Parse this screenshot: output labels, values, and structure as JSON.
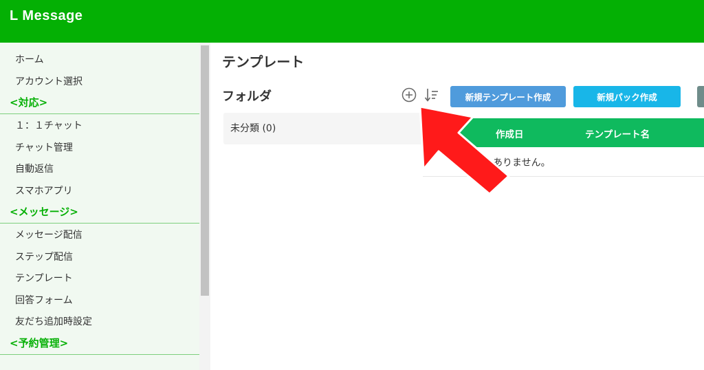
{
  "app": {
    "title": "L Message"
  },
  "sidebar": {
    "items": [
      {
        "type": "item",
        "label": "ホーム"
      },
      {
        "type": "item",
        "label": "アカウント選択"
      },
      {
        "type": "section",
        "label": "<対応>"
      },
      {
        "type": "item",
        "label": "１：１チャット"
      },
      {
        "type": "item",
        "label": "チャット管理"
      },
      {
        "type": "item",
        "label": "自動返信"
      },
      {
        "type": "item",
        "label": "スマホアプリ"
      },
      {
        "type": "section",
        "label": "<メッセージ>"
      },
      {
        "type": "item",
        "label": "メッセージ配信"
      },
      {
        "type": "item",
        "label": "ステップ配信"
      },
      {
        "type": "item",
        "label": "テンプレート"
      },
      {
        "type": "item",
        "label": "回答フォーム"
      },
      {
        "type": "item",
        "label": "友だち追加時設定"
      },
      {
        "type": "section",
        "label": "<予約管理>"
      }
    ]
  },
  "main": {
    "page_title": "テンプレート",
    "folder_title": "フォルダ",
    "add_folder_icon": "plus-circle-icon",
    "sort_icon": "sort-descending-icon",
    "new_template_button": "新規テンプレート作成",
    "new_pack_button": "新規パック作成",
    "folders": [
      {
        "label": "未分類 (0)"
      }
    ],
    "table": {
      "columns": [
        "作成日",
        "テンプレート名"
      ],
      "empty_text": "ありません。"
    }
  },
  "annotation": {
    "icon": "red-arrow-icon",
    "color": "#ff1a1a"
  },
  "colors": {
    "header": "#04b004",
    "sidebar_bg": "#f1f9f1",
    "section": "#06b006",
    "button_blue": "#4f9bdc",
    "button_cyan": "#18b6e8",
    "table_header": "#0fba5e"
  }
}
